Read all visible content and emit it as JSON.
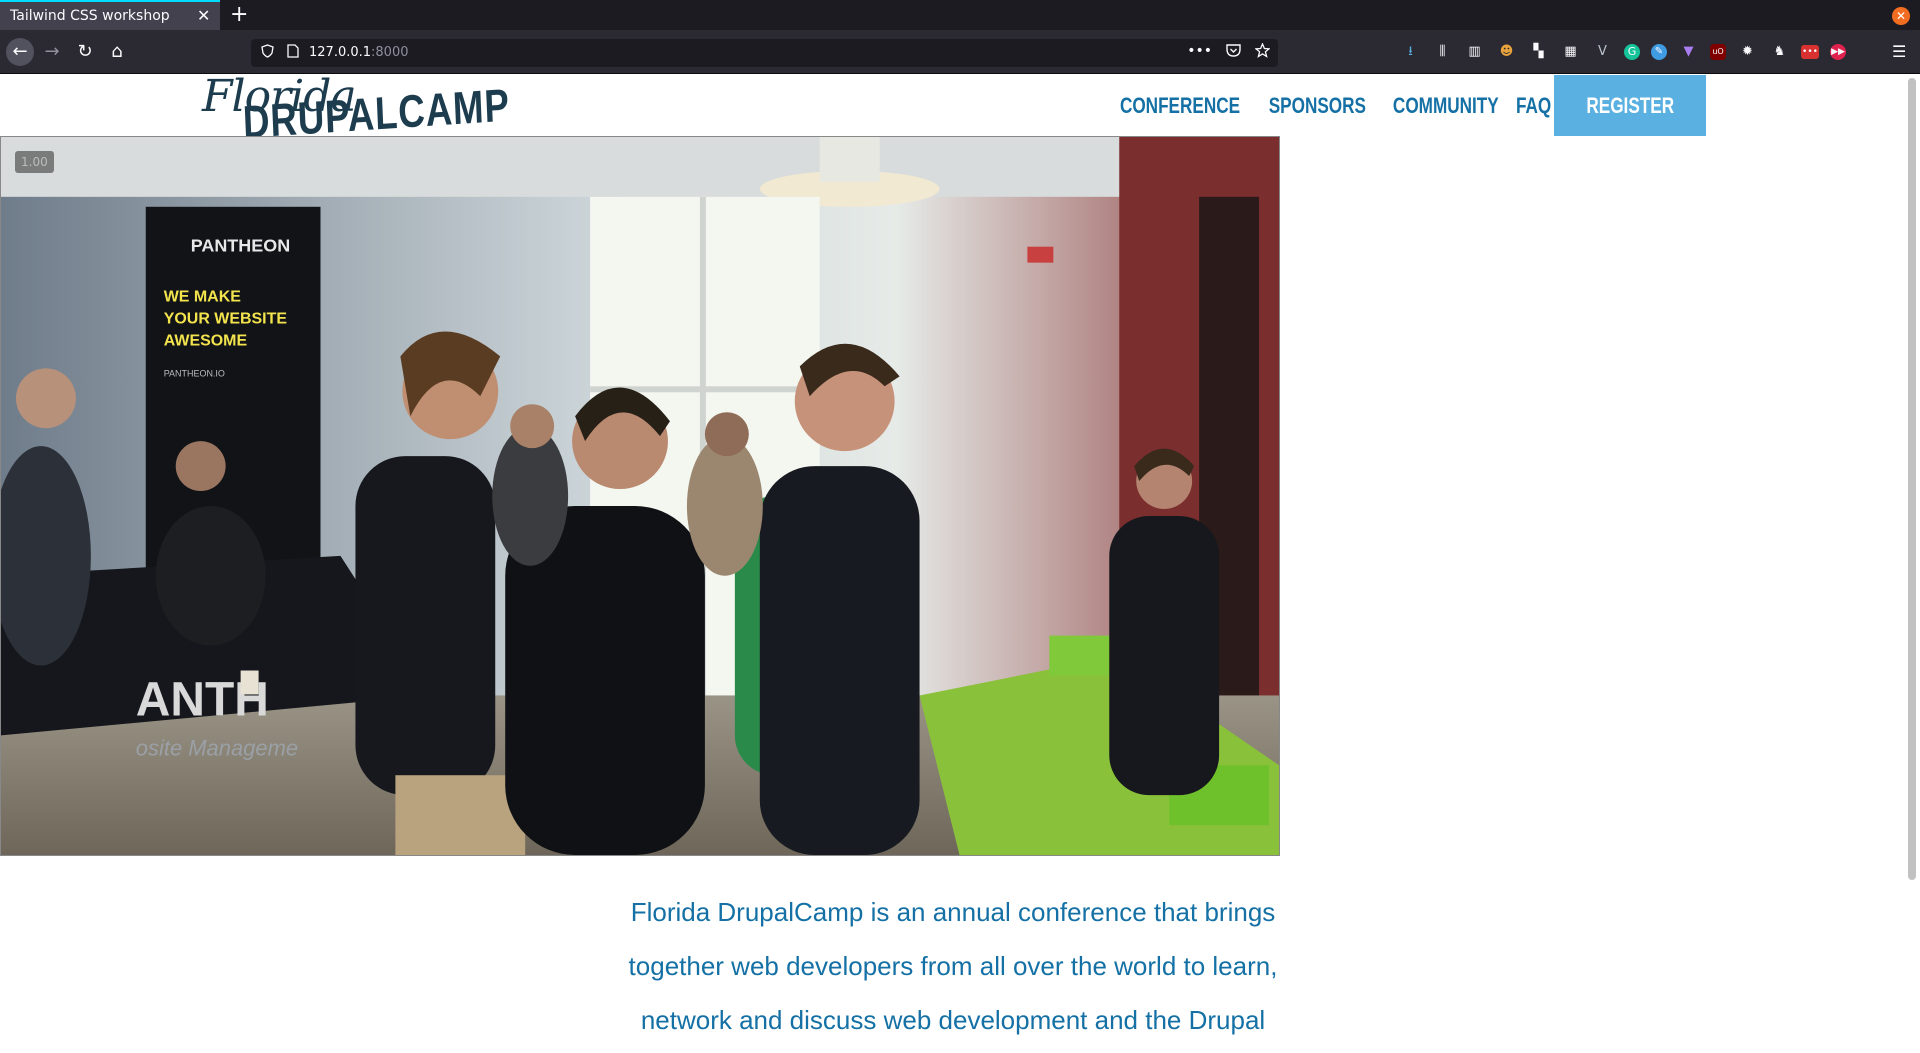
{
  "browser": {
    "tab_title": "Tailwind CSS workshop",
    "tab_close": "✕",
    "new_tab": "+",
    "window_close": "✕",
    "url_host": "127.0.0.1",
    "url_port": ":8000",
    "back_icon": "←",
    "forward_icon": "→",
    "reload_icon": "↻",
    "home_icon": "⌂",
    "menu_icon": "☰",
    "url_more": "•••",
    "extensions": [
      "downloads-icon",
      "library-icon",
      "sidebar-icon",
      "extension-1-icon",
      "extension-2-icon",
      "grid-icon",
      "vue-icon",
      "grammarly-icon",
      "extension-3-icon",
      "extension-4-icon",
      "ublock-icon",
      "settings-icon",
      "extension-5-icon",
      "extension-6-icon",
      "extension-7-icon"
    ]
  },
  "site": {
    "logo_script": "Florida",
    "logo_main": "DRUPALCAMP",
    "nav": {
      "conference": "CONFERENCE",
      "sponsors": "SPONSORS",
      "community": "COMMUNITY",
      "faq": "FAQ",
      "register": "REGISTER"
    },
    "video_speed": "1.00",
    "banner_lines": [
      "PANTHEON",
      "WE MAKE",
      "YOUR WEBSITE",
      "AWESOME",
      "PANTHEON.IO"
    ],
    "table_banner": "ANTH",
    "table_banner_sub": "osite Manageme",
    "intro_text": "Florida DrupalCamp is an annual conference that brings together web developers from all over the world to learn, network and discuss web development and the Drupal"
  },
  "colors": {
    "brand_blue": "#1571a5",
    "register_bg": "#5ab0e0",
    "logo_navy": "#1d3d4f"
  }
}
